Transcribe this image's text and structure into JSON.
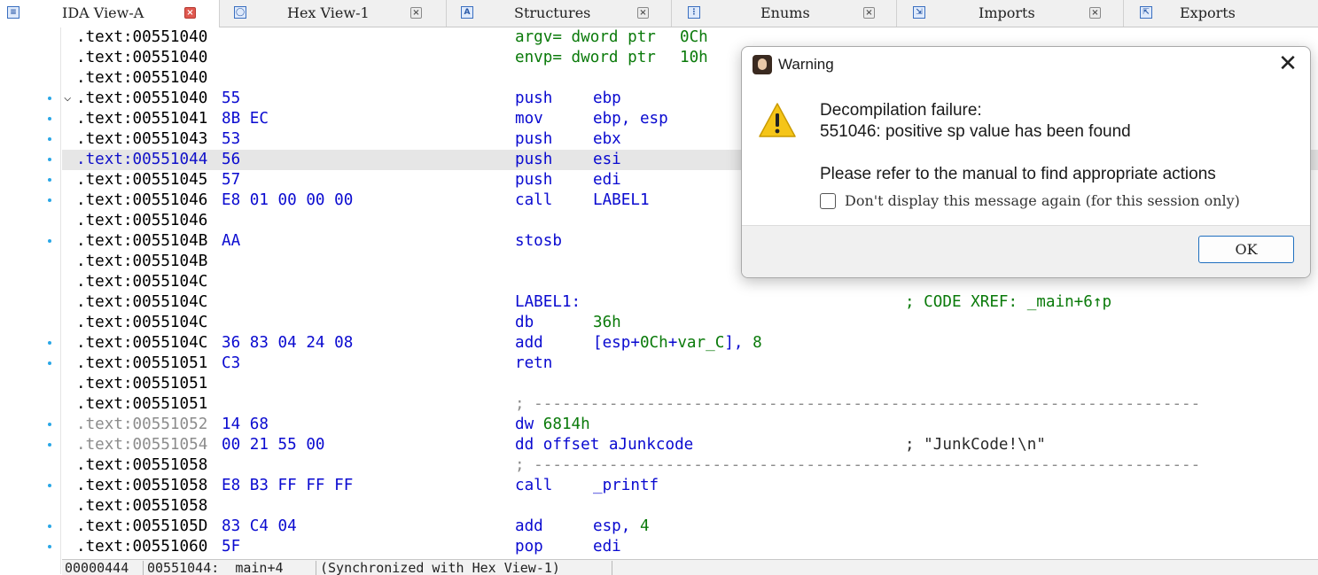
{
  "tabs": [
    {
      "label": "IDA View-A",
      "icon": "listing-icon",
      "active": true
    },
    {
      "label": "Hex View-1",
      "icon": "hex-view-icon",
      "active": false
    },
    {
      "label": "Structures",
      "icon": "structures-icon",
      "active": false
    },
    {
      "label": "Enums",
      "icon": "enums-icon",
      "active": false
    },
    {
      "label": "Imports",
      "icon": "imports-icon",
      "active": false
    },
    {
      "label": "Exports",
      "icon": "exports-icon",
      "active": false
    }
  ],
  "lines": [
    {
      "addr": ".text:00551040",
      "bytes": "",
      "mnem": "argv= dword ptr",
      "ops": "0Ch",
      "note": "",
      "addr_style": "normal"
    },
    {
      "addr": ".text:00551040",
      "bytes": "",
      "mnem": "envp= dword ptr",
      "ops": "10h",
      "note": "",
      "addr_style": "normal"
    },
    {
      "addr": ".text:00551040",
      "bytes": "",
      "mnem": "",
      "ops": "",
      "note": "",
      "addr_style": "normal"
    },
    {
      "addr": ".text:00551040",
      "bytes": "55",
      "mnem": "push",
      "ops": "ebp",
      "note": "",
      "addr_style": "normal"
    },
    {
      "addr": ".text:00551041",
      "bytes": "8B EC",
      "mnem": "mov",
      "ops": "ebp, esp",
      "note": "",
      "addr_style": "normal"
    },
    {
      "addr": ".text:00551043",
      "bytes": "53",
      "mnem": "push",
      "ops": "ebx",
      "note": "",
      "addr_style": "normal"
    },
    {
      "addr": ".text:00551044",
      "bytes": "56",
      "mnem": "push",
      "ops": "esi",
      "note": "",
      "addr_style": "highlight"
    },
    {
      "addr": ".text:00551045",
      "bytes": "57",
      "mnem": "push",
      "ops": "edi",
      "note": "",
      "addr_style": "normal"
    },
    {
      "addr": ".text:00551046",
      "bytes": "E8 01 00 00 00",
      "mnem": "call",
      "ops": "LABEL1",
      "note": "",
      "addr_style": "normal"
    },
    {
      "addr": ".text:00551046",
      "bytes": "",
      "mnem": "",
      "ops": "",
      "note": "",
      "addr_style": "normal"
    },
    {
      "addr": ".text:0055104B",
      "bytes": "AA",
      "mnem": "stosb",
      "ops": "",
      "note": "",
      "addr_style": "normal"
    },
    {
      "addr": ".text:0055104B",
      "bytes": "",
      "mnem": "",
      "ops": "",
      "note": "",
      "addr_style": "normal"
    },
    {
      "addr": ".text:0055104C",
      "bytes": "",
      "mnem": "",
      "ops": "",
      "note": "",
      "addr_style": "normal"
    },
    {
      "addr": ".text:0055104C",
      "bytes": "",
      "mnem": "LABEL1:",
      "ops": "",
      "note": "; CODE XREF: _main+6↑p",
      "addr_style": "normal"
    },
    {
      "addr": ".text:0055104C",
      "bytes": "",
      "mnem": "db",
      "ops": "36h",
      "note": "",
      "addr_style": "normal"
    },
    {
      "addr": ".text:0055104C",
      "bytes": "36 83 04 24 08",
      "mnem": "add",
      "ops": "[esp+0Ch+var_C], 8",
      "note": "",
      "addr_style": "normal"
    },
    {
      "addr": ".text:00551051",
      "bytes": "C3",
      "mnem": "retn",
      "ops": "",
      "note": "",
      "addr_style": "normal"
    },
    {
      "addr": ".text:00551051",
      "bytes": "",
      "mnem": "",
      "ops": "",
      "note": "",
      "addr_style": "normal"
    },
    {
      "addr": ".text:00551051",
      "bytes": "",
      "mnem": "; -----------------------------------------------------------------------",
      "ops": "",
      "note": "",
      "addr_style": "normal"
    },
    {
      "addr": ".text:00551052",
      "bytes": "14 68",
      "mnem": "dw 6814h",
      "ops": "",
      "note": "",
      "addr_style": "grey"
    },
    {
      "addr": ".text:00551054",
      "bytes": "00 21 55 00",
      "mnem": "dd offset aJunkcode",
      "ops": "",
      "note": "; \"JunkCode!\\n\"",
      "addr_style": "grey"
    },
    {
      "addr": ".text:00551058",
      "bytes": "",
      "mnem": "; -----------------------------------------------------------------------",
      "ops": "",
      "note": "",
      "addr_style": "normal"
    },
    {
      "addr": ".text:00551058",
      "bytes": "E8 B3 FF FF FF",
      "mnem": "call",
      "ops": "_printf",
      "note": "",
      "addr_style": "normal"
    },
    {
      "addr": ".text:00551058",
      "bytes": "",
      "mnem": "",
      "ops": "",
      "note": "",
      "addr_style": "normal"
    },
    {
      "addr": ".text:0055105D",
      "bytes": "83 C4 04",
      "mnem": "add",
      "ops": "esp, 4",
      "note": "",
      "addr_style": "normal"
    },
    {
      "addr": ".text:00551060",
      "bytes": "5F",
      "mnem": "pop",
      "ops": "edi",
      "note": "",
      "addr_style": "normal"
    }
  ],
  "status": {
    "offset": "00000444",
    "location": "00551044: _main+4",
    "sync": "(Synchronized with Hex View-1)"
  },
  "dialog": {
    "title": "Warning",
    "line1": "Decompilation failure:",
    "line2": "551046: positive sp value has been found",
    "line3": "Please refer to the manual to find appropriate actions",
    "checkbox_label": "Don't display this message again (for this session only)",
    "checkbox_checked": false,
    "ok_label": "OK"
  },
  "colors": {
    "code_blue": "#0a0ad0",
    "number_green": "#0a7a0a",
    "current_line": "#e6e6e6",
    "gutter_dot": "#2aa7e6",
    "active_tab_close": "#e0584f"
  }
}
